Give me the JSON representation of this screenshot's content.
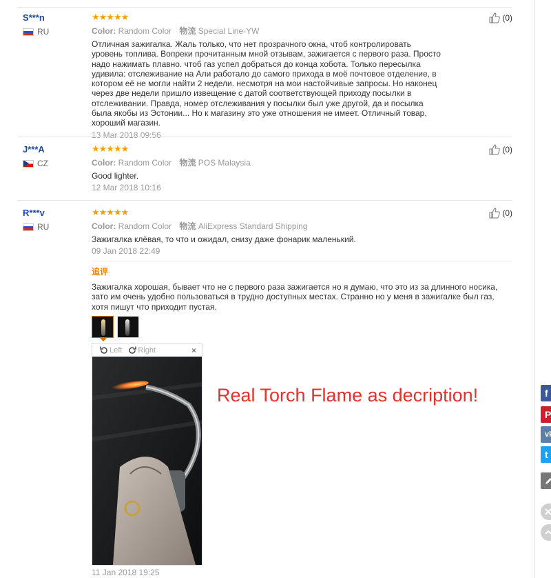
{
  "reviews": [
    {
      "user": "S***n",
      "country": "RU",
      "stars": "★★★★★",
      "color_label": "Color:",
      "color_value": "Random Color",
      "ship_key": "物流",
      "ship_value": "Special Line-YW",
      "text": "Отличная зажигалка. Жаль только, что нет прозрачного окна, чтоб контролировать уровень топлива. Вопреки прочитанным мной отзывам, зажигается с первого раза. Просто надо нажимать плавно. чтоб газ успел добраться до конца хобота. Только пересылка удивила: отслеживание на Али работало до самого прихода в моё почтовое отделение, в котором её не могли найти 2 недели. несмотря на мои настойчивые запросы. Но наконец через две недели пришло извещение с датой соответствующей приходу посылки в отслеживании. Правда, номер отслеживания у посылки был уже другой, да и посылка была якобы из Эстонии... Но к магазину это уже отношения не имеет. Отличный товар, хороший магазин.",
      "date": "13 Mar 2018 09:56",
      "helpful": "(0)"
    },
    {
      "user": "J***A",
      "country": "CZ",
      "stars": "★★★★★",
      "color_label": "Color:",
      "color_value": "Random Color",
      "ship_key": "物流",
      "ship_value": "POS Malaysia",
      "text": "Good lighter.",
      "date": "12 Mar 2018 10:16",
      "helpful": "(0)"
    },
    {
      "user": "R***v",
      "country": "RU",
      "stars": "★★★★★",
      "color_label": "Color:",
      "color_value": "Random Color",
      "ship_key": "物流",
      "ship_value": "AliExpress Standard Shipping",
      "text": "Зажигалка клёвая, то что и ожидал, снизу даже фонарик маленький.",
      "date": "09 Jan 2018 22:49",
      "helpful": "(0)",
      "additional": {
        "label": "追评",
        "text": "Зажигалка хорошая, бывает что не с первого раза зажигается но я думаю, что это из за длинного носика, зато им очень удобно пользоваться в трудно доступных местах. Странно но у меня в зажигалке был газ, хотя пишут что приходит пустая.",
        "date": "11 Jan 2018 19:25"
      }
    }
  ],
  "viewer": {
    "rotate_left": "Left",
    "rotate_right": "Right",
    "close": "×"
  },
  "promo_text": "Real Torch Flame as decription!",
  "share": {
    "facebook": "f",
    "pinterest": "P",
    "vk": "vk",
    "twitter": "t"
  },
  "colors": {
    "username": "#1d4c9c",
    "stars": "#f5a000",
    "promo": "#e2322c",
    "followup_label": "#f08000"
  }
}
